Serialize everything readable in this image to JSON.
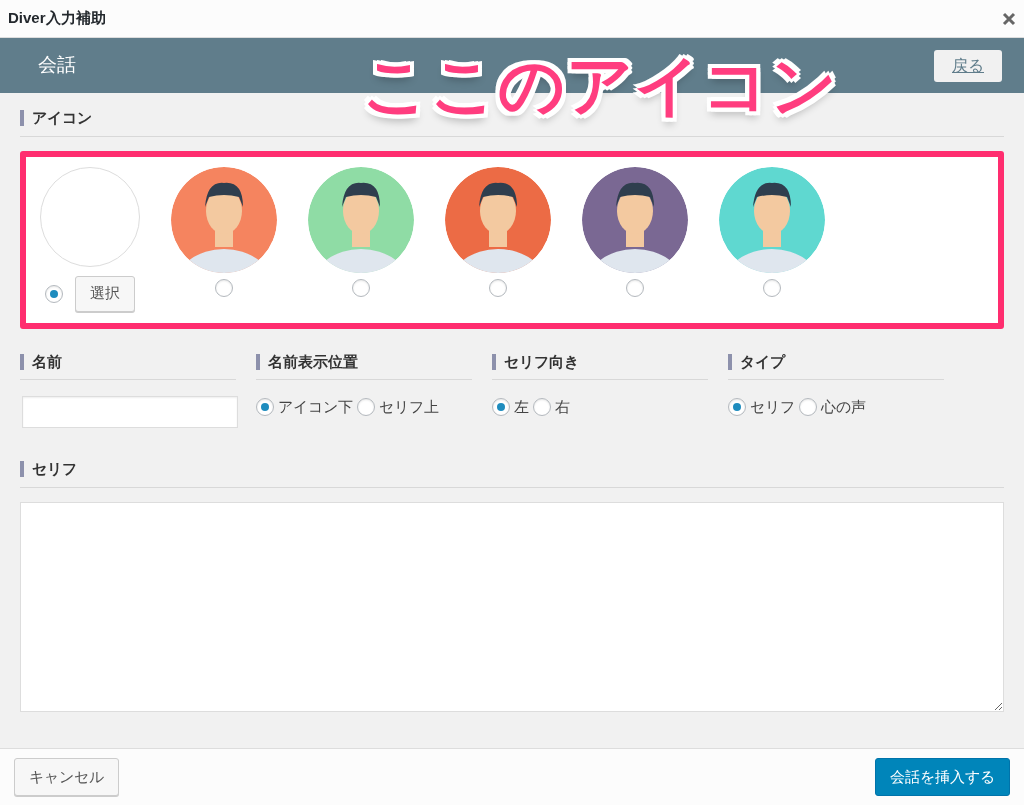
{
  "window": {
    "title": "Diver入力補助"
  },
  "header": {
    "title": "会話",
    "back_button": "戻る"
  },
  "annotation": "ここのアイコン",
  "icon_section": {
    "label": "アイコン",
    "options": [
      {
        "kind": "custom",
        "selected": true,
        "button": "選択"
      },
      {
        "kind": "avatar",
        "selected": false,
        "color": "#f5845f"
      },
      {
        "kind": "avatar",
        "selected": false,
        "color": "#8fdca5"
      },
      {
        "kind": "avatar",
        "selected": false,
        "color": "#ec6b45"
      },
      {
        "kind": "avatar",
        "selected": false,
        "color": "#7a6893"
      },
      {
        "kind": "avatar",
        "selected": false,
        "color": "#5fd8d0"
      }
    ]
  },
  "fields": [
    {
      "kind": "text",
      "label": "名前"
    },
    {
      "kind": "radio",
      "label": "名前表示位置",
      "options": [
        {
          "label": "アイコン下",
          "selected": true
        },
        {
          "label": "セリフ上",
          "selected": false
        }
      ]
    },
    {
      "kind": "radio",
      "label": "セリフ向き",
      "options": [
        {
          "label": "左",
          "selected": true
        },
        {
          "label": "右",
          "selected": false
        }
      ]
    },
    {
      "kind": "radio",
      "label": "タイプ",
      "options": [
        {
          "label": "セリフ",
          "selected": true
        },
        {
          "label": "心の声",
          "selected": false
        }
      ]
    }
  ],
  "speech": {
    "label": "セリフ"
  },
  "footer": {
    "cancel": "キャンセル",
    "insert": "会話を挿入する"
  }
}
